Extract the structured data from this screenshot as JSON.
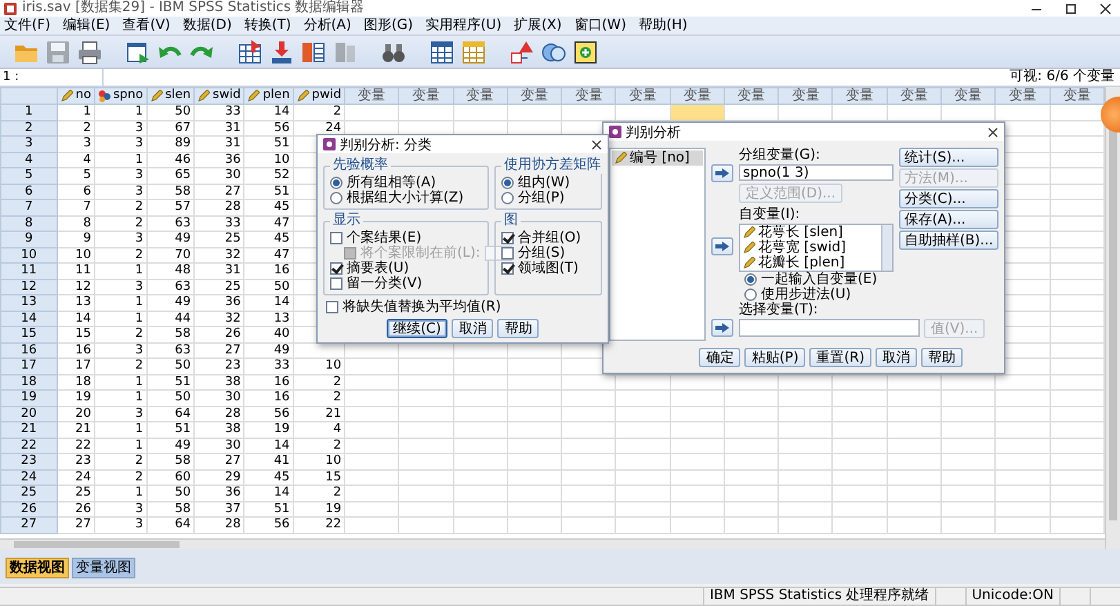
{
  "window": {
    "title": "iris.sav [数据集29] - IBM SPSS Statistics 数据编辑器"
  },
  "menu": [
    "文件(F)",
    "编辑(E)",
    "查看(V)",
    "数据(D)",
    "转换(T)",
    "分析(A)",
    "图形(G)",
    "实用程序(U)",
    "扩展(X)",
    "窗口(W)",
    "帮助(H)"
  ],
  "toolbar": [
    {
      "kind": "folder",
      "disabled": false
    },
    {
      "kind": "disk",
      "disabled": true
    },
    {
      "kind": "printer",
      "disabled": false
    },
    {
      "kind": "recall",
      "disabled": false
    },
    {
      "kind": "undo",
      "disabled": false
    },
    {
      "kind": "redo",
      "disabled": false
    },
    {
      "kind": "goto_case",
      "disabled": false
    },
    {
      "kind": "goto_var",
      "disabled": false
    },
    {
      "kind": "variables",
      "disabled": false
    },
    {
      "kind": "split",
      "disabled": true
    },
    {
      "kind": "find",
      "disabled": false
    },
    {
      "kind": "insert_case",
      "disabled": false
    },
    {
      "kind": "insert_var",
      "disabled": false
    },
    {
      "kind": "labels",
      "disabled": false
    },
    {
      "kind": "sets",
      "disabled": false
    },
    {
      "kind": "spell",
      "disabled": false
    }
  ],
  "cell_editor": {
    "cell": "1 :",
    "visible": "可视: 6/6 个变量"
  },
  "grid": {
    "columns": [
      {
        "name": "no",
        "kind": "scale"
      },
      {
        "name": "spno",
        "kind": "nominal"
      },
      {
        "name": "slen",
        "kind": "scale"
      },
      {
        "name": "swid",
        "kind": "scale"
      },
      {
        "name": "plen",
        "kind": "scale"
      },
      {
        "name": "pwid",
        "kind": "scale"
      }
    ],
    "variable_columns": [
      {
        "label": "变量",
        "selected": false
      },
      {
        "label": "变量",
        "selected": false
      },
      {
        "label": "变量",
        "selected": false
      },
      {
        "label": "变量",
        "selected": false
      },
      {
        "label": "变量",
        "selected": false
      },
      {
        "label": "变量",
        "selected": false
      },
      {
        "label": "变量",
        "selected": true
      },
      {
        "label": "变量",
        "selected": false
      },
      {
        "label": "变量",
        "selected": false
      },
      {
        "label": "变量",
        "selected": false
      },
      {
        "label": "变量",
        "selected": false
      },
      {
        "label": "变量",
        "selected": false
      },
      {
        "label": "变量",
        "selected": false
      },
      {
        "label": "变量",
        "selected": false
      }
    ],
    "rows": [
      {
        "label": "1",
        "values": [
          "1",
          "1",
          "50",
          "33",
          "14",
          "2"
        ]
      },
      {
        "label": "2",
        "values": [
          "2",
          "3",
          "67",
          "31",
          "56",
          "24"
        ]
      },
      {
        "label": "3",
        "values": [
          "3",
          "3",
          "89",
          "31",
          "51"
        ]
      },
      {
        "label": "4",
        "values": [
          "4",
          "1",
          "46",
          "36",
          "10"
        ]
      },
      {
        "label": "5",
        "values": [
          "5",
          "3",
          "65",
          "30",
          "52"
        ]
      },
      {
        "label": "6",
        "values": [
          "6",
          "3",
          "58",
          "27",
          "51"
        ]
      },
      {
        "label": "7",
        "values": [
          "7",
          "2",
          "57",
          "28",
          "45"
        ]
      },
      {
        "label": "8",
        "values": [
          "8",
          "2",
          "63",
          "33",
          "47"
        ]
      },
      {
        "label": "9",
        "values": [
          "9",
          "3",
          "49",
          "25",
          "45"
        ]
      },
      {
        "label": "10",
        "values": [
          "10",
          "2",
          "70",
          "32",
          "47"
        ]
      },
      {
        "label": "11",
        "values": [
          "11",
          "1",
          "48",
          "31",
          "16"
        ]
      },
      {
        "label": "12",
        "values": [
          "12",
          "3",
          "63",
          "25",
          "50"
        ]
      },
      {
        "label": "13",
        "values": [
          "13",
          "1",
          "49",
          "36",
          "14"
        ]
      },
      {
        "label": "14",
        "values": [
          "14",
          "1",
          "44",
          "32",
          "13"
        ]
      },
      {
        "label": "15",
        "values": [
          "15",
          "2",
          "58",
          "26",
          "40"
        ]
      },
      {
        "label": "16",
        "values": [
          "16",
          "3",
          "63",
          "27",
          "49"
        ]
      },
      {
        "label": "17",
        "values": [
          "17",
          "2",
          "50",
          "23",
          "33",
          "10"
        ]
      },
      {
        "label": "18",
        "values": [
          "18",
          "1",
          "51",
          "38",
          "16",
          "2"
        ]
      },
      {
        "label": "19",
        "values": [
          "19",
          "1",
          "50",
          "30",
          "16",
          "2"
        ]
      },
      {
        "label": "20",
        "values": [
          "20",
          "3",
          "64",
          "28",
          "56",
          "21"
        ]
      },
      {
        "label": "21",
        "values": [
          "21",
          "1",
          "51",
          "38",
          "19",
          "4"
        ]
      },
      {
        "label": "22",
        "values": [
          "22",
          "1",
          "49",
          "30",
          "14",
          "2"
        ]
      },
      {
        "label": "23",
        "values": [
          "23",
          "2",
          "58",
          "27",
          "41",
          "10"
        ]
      },
      {
        "label": "24",
        "values": [
          "24",
          "2",
          "60",
          "29",
          "45",
          "15"
        ]
      },
      {
        "label": "25",
        "values": [
          "25",
          "1",
          "50",
          "36",
          "14",
          "2"
        ]
      },
      {
        "label": "26",
        "values": [
          "26",
          "3",
          "58",
          "37",
          "51",
          "19"
        ]
      },
      {
        "label": "27",
        "values": [
          "27",
          "3",
          "64",
          "28",
          "56",
          "22"
        ]
      }
    ]
  },
  "sheet_tabs": [
    {
      "label": "数据视图",
      "selected": true
    },
    {
      "label": "变量视图",
      "selected": false
    }
  ],
  "status_bar": {
    "message": "IBM SPSS Statistics 处理程序就绪",
    "unicode": "Unicode:ON"
  },
  "main_dialog": {
    "title": "判别分析",
    "source_list": [
      {
        "label": "编号 [no]",
        "selected": true
      }
    ],
    "grouping": {
      "label": "分组变量(G):",
      "value": "spno(1 3)",
      "define_button": {
        "label": "定义范围(D)...",
        "disabled": true
      }
    },
    "independents": {
      "label": "自变量(I):",
      "items": [
        "花萼长 [slen]",
        "花萼宽 [swid]",
        "花瓣长 [plen]"
      ]
    },
    "entry_methods": [
      {
        "label": "一起输入自变量(E)",
        "selected": true
      },
      {
        "label": "使用步进法(U)",
        "selected": false
      }
    ],
    "selection": {
      "label": "选择变量(T):",
      "value_button": {
        "label": "值(V)...",
        "disabled": true
      }
    },
    "side_buttons": [
      {
        "label": "统计(S)...",
        "disabled": false
      },
      {
        "label": "方法(M)...",
        "disabled": true
      },
      {
        "label": "分类(C)...",
        "disabled": false
      },
      {
        "label": "保存(A)...",
        "disabled": false
      },
      {
        "label": "自助抽样(B)...",
        "disabled": false
      }
    ],
    "buttons": [
      "确定",
      "粘贴(P)",
      "重置(R)",
      "取消",
      "帮助"
    ]
  },
  "classify_dialog": {
    "title": "判别分析: 分类",
    "groups": [
      {
        "title": "先验概率",
        "options": [
          {
            "kind": "radio",
            "label": "所有组相等(A)",
            "selected": true
          },
          {
            "kind": "radio",
            "label": "根据组大小计算(Z)",
            "selected": false
          }
        ]
      },
      {
        "title": "使用协方差矩阵",
        "options": [
          {
            "kind": "radio",
            "label": "组内(W)",
            "selected": true
          },
          {
            "kind": "radio",
            "label": "分组(P)",
            "selected": false
          }
        ]
      },
      {
        "title": "显示",
        "options": [
          {
            "kind": "checkbox",
            "label": "个案结果(E)",
            "checked": false
          },
          {
            "kind": "limit",
            "label": "将个案限制在前(L):",
            "checked": false,
            "disabled": true
          },
          {
            "kind": "checkbox",
            "label": "摘要表(U)",
            "checked": true
          },
          {
            "kind": "checkbox",
            "label": "留一分类(V)",
            "checked": false
          }
        ]
      },
      {
        "title": "图",
        "options": [
          {
            "kind": "checkbox",
            "label": "合并组(O)",
            "checked": true
          },
          {
            "kind": "checkbox",
            "label": "分组(S)",
            "checked": false
          },
          {
            "kind": "checkbox",
            "label": "领域图(T)",
            "checked": true
          }
        ]
      }
    ],
    "missing": {
      "label": "将缺失值替换为平均值(R)",
      "checked": false
    },
    "buttons": [
      {
        "label": "继续(C)",
        "default": true
      },
      {
        "label": "取消",
        "default": false
      },
      {
        "label": "帮助",
        "default": false
      }
    ]
  }
}
